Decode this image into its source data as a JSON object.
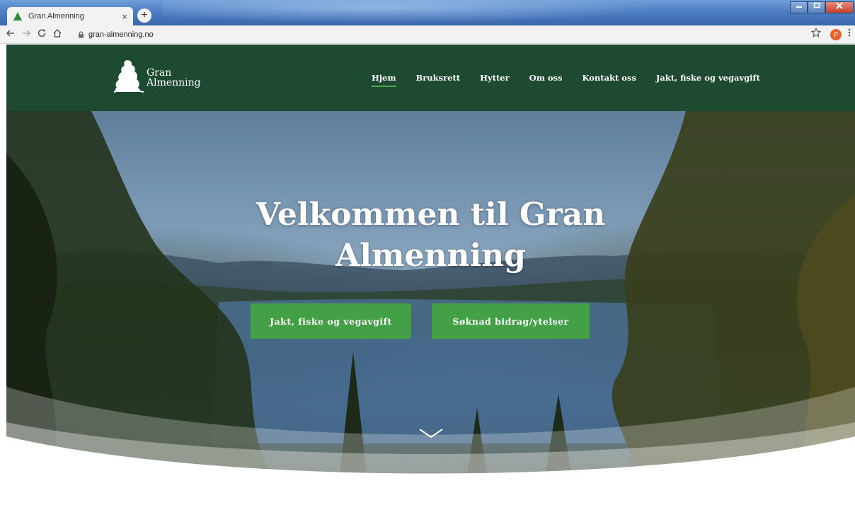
{
  "browser": {
    "tab_title": "Gran Almenning",
    "tab_close": "×",
    "new_tab": "+",
    "url": "gran-almenning.no",
    "profile_initial": "P",
    "icons": {
      "back": "arrow-left-icon",
      "forward": "arrow-right-icon",
      "reload": "reload-icon",
      "home": "home-icon",
      "lock": "lock-icon",
      "star": "star-icon",
      "menu": "kebab-menu-icon"
    }
  },
  "site": {
    "logo": {
      "line1": "Gran",
      "line2": "Almenning"
    },
    "nav": [
      {
        "label": "Hjem",
        "active": true
      },
      {
        "label": "Bruksrett",
        "active": false
      },
      {
        "label": "Hytter",
        "active": false
      },
      {
        "label": "Om oss",
        "active": false
      },
      {
        "label": "Kontakt oss",
        "active": false
      },
      {
        "label": "Jakt, fiske og vegavgift",
        "active": false
      }
    ],
    "hero": {
      "title_line1": "Velkommen til Gran",
      "title_line2": "Almenning",
      "buttons": [
        {
          "label": "Jakt, fiske og vegavgift"
        },
        {
          "label": "Søknad bidrag/ytelser"
        }
      ],
      "scroll_icon": "chevron-down-icon"
    }
  },
  "colors": {
    "header_bg": "#1f4a32",
    "accent_green": "#43a047",
    "active_underline": "#4caf50"
  }
}
